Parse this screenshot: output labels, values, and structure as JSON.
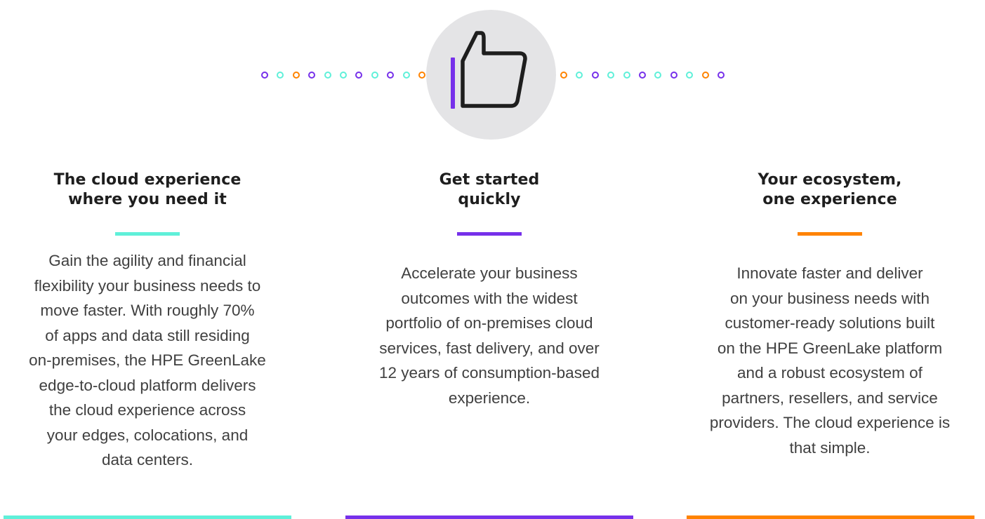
{
  "colors": {
    "teal": "#5ff0d9",
    "purple": "#7630ea",
    "orange": "#ff8300",
    "circle": "#e4e4e6",
    "icon_stroke": "#1e1e1e"
  },
  "hero": {
    "icon": "thumbs-up-icon",
    "left_dots": [
      "purple",
      "teal",
      "orange",
      "purple",
      "teal",
      "teal",
      "purple",
      "teal",
      "purple",
      "teal",
      "orange"
    ],
    "right_dots": [
      "orange",
      "teal",
      "purple",
      "teal",
      "teal",
      "purple",
      "teal",
      "purple",
      "teal",
      "orange",
      "purple"
    ]
  },
  "columns": [
    {
      "accent": "teal",
      "title_lines": [
        "The cloud experience",
        "where you need it"
      ],
      "body_lines": [
        "Gain the agility and financial",
        "flexibility your business needs to",
        "move faster. With roughly 70%",
        "of apps and data still residing",
        "on-premises, the HPE GreenLake",
        "edge-to-cloud platform delivers",
        "the cloud experience across",
        "your edges, colocations, and",
        "data centers."
      ]
    },
    {
      "accent": "purple",
      "title_lines": [
        "Get started",
        "quickly"
      ],
      "body_lines": [
        "Accelerate your business",
        "outcomes with the widest",
        "portfolio of on-premises cloud",
        "services, fast delivery, and over",
        "12 years of consumption-based",
        "experience."
      ]
    },
    {
      "accent": "orange",
      "title_lines": [
        "Your ecosystem,",
        "one experience"
      ],
      "body_lines": [
        "Innovate faster and deliver",
        "on your business needs with",
        "customer-ready solutions built",
        "on the HPE GreenLake platform",
        "and a robust ecosystem of",
        "partners, resellers, and service",
        "providers. The cloud experience is",
        "that simple."
      ]
    }
  ]
}
